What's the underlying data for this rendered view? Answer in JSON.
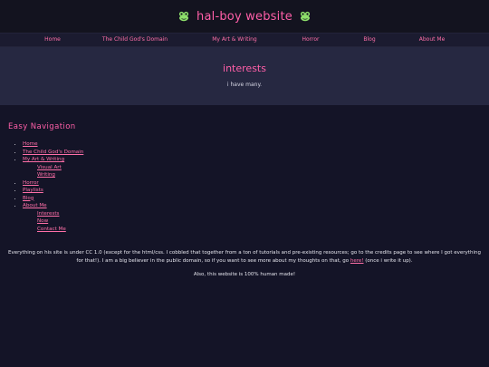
{
  "header": {
    "title": "hal-boy website"
  },
  "topnav": {
    "items": [
      {
        "label": "Home"
      },
      {
        "label": "The Child God's Domain"
      },
      {
        "label": "My Art & Writing"
      },
      {
        "label": "Horror"
      },
      {
        "label": "Blog"
      },
      {
        "label": "About Me"
      }
    ]
  },
  "hero": {
    "title": "interests",
    "subtitle": "i have many."
  },
  "sidebar": {
    "heading": "Easy Navigation",
    "items": [
      {
        "label": "Home"
      },
      {
        "label": "The Child God's Domain"
      },
      {
        "label": "My Art & Writing",
        "children": [
          {
            "label": "Visual Art"
          },
          {
            "label": "Writing"
          }
        ]
      },
      {
        "label": "Horror"
      },
      {
        "label": "Playlists"
      },
      {
        "label": "Blog"
      },
      {
        "label": "About Me",
        "children": [
          {
            "label": "Interests"
          },
          {
            "label": "Now"
          },
          {
            "label": "Contact Me"
          }
        ]
      }
    ]
  },
  "footer": {
    "text_before": "Everything on his site is under CC 1.0 (except for the html/css. I cobbled that together from a ton of tutorials and pre-existing resources; go to the credits page to see where I got everything for that!). I am a big believer in the public domain, so if you want to see more about my thoughts on that, go ",
    "link": "here!",
    "text_after": " (once i write it up).",
    "note": "Also, this website is 100% human made!"
  },
  "colors": {
    "accent": "#ff5fa8",
    "background": "#141427",
    "hero_band": "#262841",
    "frog_green": "#8ee06b"
  },
  "icons": {
    "header_left": "frog-icon",
    "header_right": "frog-icon"
  }
}
